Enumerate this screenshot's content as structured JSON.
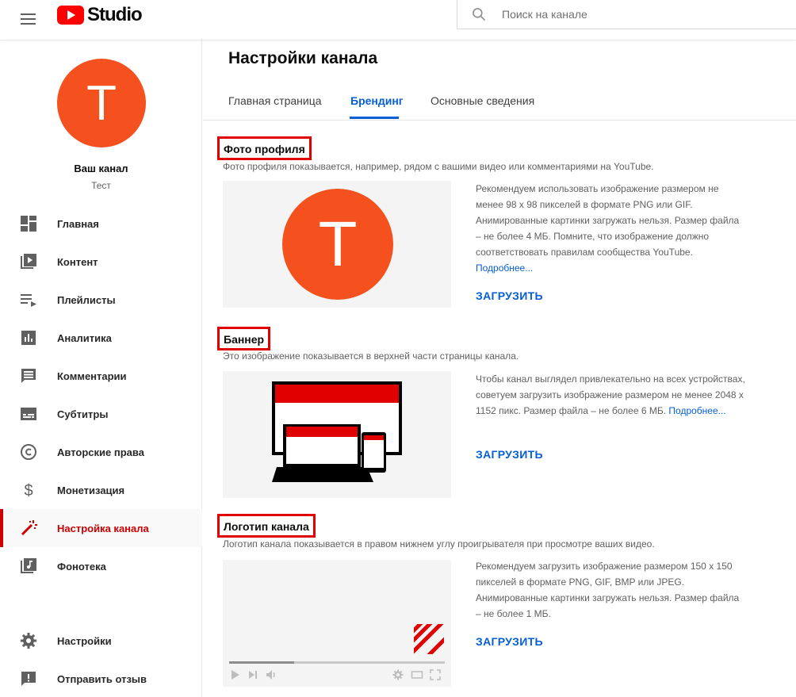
{
  "header": {
    "logo_text": "Studio",
    "search_placeholder": "Поиск на канале"
  },
  "sidebar": {
    "avatar_letter": "T",
    "channel_title": "Ваш канал",
    "channel_subtitle": "Тест",
    "items": [
      {
        "label": "Главная",
        "icon": "dashboard-icon"
      },
      {
        "label": "Контент",
        "icon": "video-library-icon"
      },
      {
        "label": "Плейлисты",
        "icon": "playlist-icon"
      },
      {
        "label": "Аналитика",
        "icon": "analytics-icon"
      },
      {
        "label": "Комментарии",
        "icon": "comments-icon"
      },
      {
        "label": "Субтитры",
        "icon": "subtitles-icon"
      },
      {
        "label": "Авторские права",
        "icon": "copyright-icon"
      },
      {
        "label": "Монетизация",
        "icon": "dollar-icon"
      },
      {
        "label": "Настройка канала",
        "icon": "magic-wand-icon",
        "active": true
      },
      {
        "label": "Фонотека",
        "icon": "audio-library-icon"
      }
    ],
    "bottom_items": [
      {
        "label": "Настройки",
        "icon": "gear-icon"
      },
      {
        "label": "Отправить отзыв",
        "icon": "feedback-icon"
      }
    ]
  },
  "main": {
    "title": "Настройки канала",
    "tabs": [
      {
        "label": "Главная страница"
      },
      {
        "label": "Брендинг",
        "active": true
      },
      {
        "label": "Основные сведения"
      }
    ],
    "sections": [
      {
        "title": "Фото профиля",
        "description": "Фото профиля показывается, например, рядом с вашими видео или комментариями на YouTube.",
        "info": "Рекомендуем использовать изображение размером не менее 98 x 98 пикселей в формате PNG или GIF. Анимированные картинки загружать нельзя. Размер файла – не более 4 МБ. Помните, что изображение должно соответствовать правилам сообщества YouTube.",
        "more_link": "Подробнее...",
        "upload_label": "ЗАГРУЗИТЬ"
      },
      {
        "title": "Баннер",
        "description": "Это изображение показывается в верхней части страницы канала.",
        "info": "Чтобы канал выглядел привлекательно на всех устройствах, советуем загрузить изображение размером не менее 2048 x 1152 пикс. Размер файла – не более 6 МБ.",
        "more_link": "Подробнее...",
        "upload_label": "ЗАГРУЗИТЬ"
      },
      {
        "title": "Логотип канала",
        "description": "Логотип канала показывается в правом нижнем углу проигрывателя при просмотре ваших видео.",
        "info": "Рекомендуем загрузить изображение размером 150 x 150 пикселей в формате PNG, GIF, BMP или JPEG. Анимированные картинки загружать нельзя. Размер файла – не более 1 МБ.",
        "upload_label": "ЗАГРУЗИТЬ"
      }
    ],
    "player_progress_fraction": 0.3
  },
  "colors": {
    "brand_red": "#ff0000",
    "avatar_orange": "#f4511e",
    "link_blue": "#065fd4",
    "active_red": "#cc0000",
    "highlight_box_red": "#e00000"
  }
}
